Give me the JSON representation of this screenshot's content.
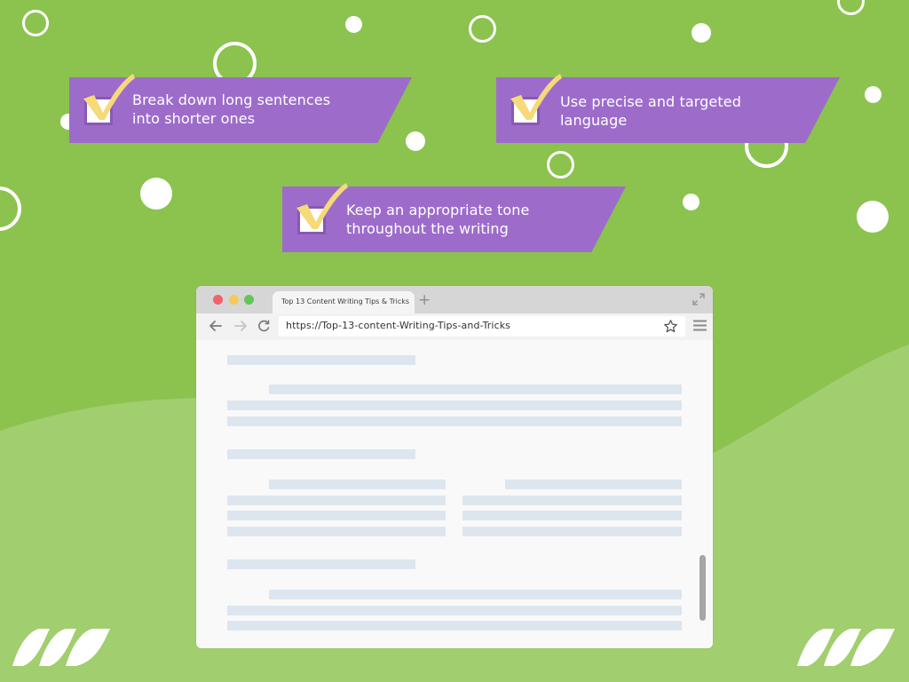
{
  "colors": {
    "background_dark_green": "#8bc34e",
    "background_light_green": "#a1ce6e",
    "banner_purple": "#9d6ccb",
    "check_yellow": "#f6d979",
    "skeleton_line": "#dde6ef",
    "traffic_red": "#f2626a",
    "traffic_yellow": "#f4c95d",
    "traffic_green": "#62c65a"
  },
  "tips": [
    {
      "icon": "checkbox-check-icon",
      "line1": "Break down long sentences",
      "line2": "into shorter ones"
    },
    {
      "icon": "checkbox-check-icon",
      "line1": "Use precise and targeted",
      "line2": "language"
    },
    {
      "icon": "checkbox-check-icon",
      "line1": "Keep an appropriate tone",
      "line2": "throughout the writing"
    }
  ],
  "browser": {
    "tab_title": "Top 13 Content Writing Tips & Tricks",
    "new_tab_symbol": "+",
    "url": "https://Top-13-content-Writing-Tips-and-Tricks",
    "icons": {
      "back": "arrow-left-icon",
      "forward": "arrow-right-icon",
      "reload": "reload-icon",
      "bookmark": "star-icon",
      "menu": "hamburger-menu-icon",
      "fullscreen": "expand-icon"
    },
    "content_placeholder": "skeleton text lines"
  },
  "logos": [
    "brand-stripes-logo",
    "brand-stripes-logo"
  ]
}
